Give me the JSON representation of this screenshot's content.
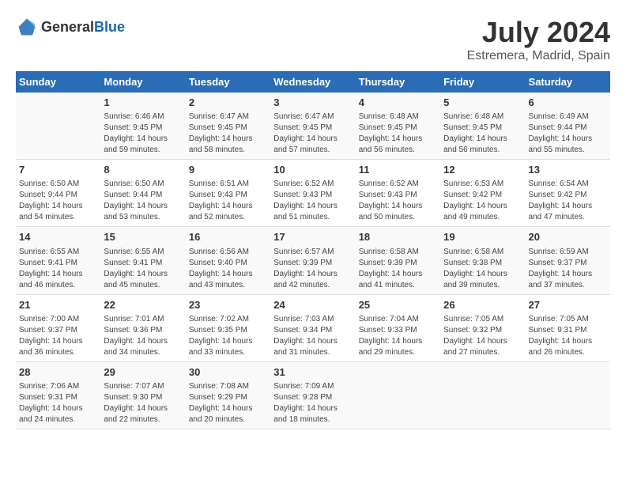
{
  "header": {
    "logo_general": "General",
    "logo_blue": "Blue",
    "title": "July 2024",
    "subtitle": "Estremera, Madrid, Spain"
  },
  "columns": [
    "Sunday",
    "Monday",
    "Tuesday",
    "Wednesday",
    "Thursday",
    "Friday",
    "Saturday"
  ],
  "weeks": [
    [
      {
        "day": "",
        "sunrise": "",
        "sunset": "",
        "daylight": ""
      },
      {
        "day": "1",
        "sunrise": "Sunrise: 6:46 AM",
        "sunset": "Sunset: 9:45 PM",
        "daylight": "Daylight: 14 hours and 59 minutes."
      },
      {
        "day": "2",
        "sunrise": "Sunrise: 6:47 AM",
        "sunset": "Sunset: 9:45 PM",
        "daylight": "Daylight: 14 hours and 58 minutes."
      },
      {
        "day": "3",
        "sunrise": "Sunrise: 6:47 AM",
        "sunset": "Sunset: 9:45 PM",
        "daylight": "Daylight: 14 hours and 57 minutes."
      },
      {
        "day": "4",
        "sunrise": "Sunrise: 6:48 AM",
        "sunset": "Sunset: 9:45 PM",
        "daylight": "Daylight: 14 hours and 56 minutes."
      },
      {
        "day": "5",
        "sunrise": "Sunrise: 6:48 AM",
        "sunset": "Sunset: 9:45 PM",
        "daylight": "Daylight: 14 hours and 56 minutes."
      },
      {
        "day": "6",
        "sunrise": "Sunrise: 6:49 AM",
        "sunset": "Sunset: 9:44 PM",
        "daylight": "Daylight: 14 hours and 55 minutes."
      }
    ],
    [
      {
        "day": "7",
        "sunrise": "Sunrise: 6:50 AM",
        "sunset": "Sunset: 9:44 PM",
        "daylight": "Daylight: 14 hours and 54 minutes."
      },
      {
        "day": "8",
        "sunrise": "Sunrise: 6:50 AM",
        "sunset": "Sunset: 9:44 PM",
        "daylight": "Daylight: 14 hours and 53 minutes."
      },
      {
        "day": "9",
        "sunrise": "Sunrise: 6:51 AM",
        "sunset": "Sunset: 9:43 PM",
        "daylight": "Daylight: 14 hours and 52 minutes."
      },
      {
        "day": "10",
        "sunrise": "Sunrise: 6:52 AM",
        "sunset": "Sunset: 9:43 PM",
        "daylight": "Daylight: 14 hours and 51 minutes."
      },
      {
        "day": "11",
        "sunrise": "Sunrise: 6:52 AM",
        "sunset": "Sunset: 9:43 PM",
        "daylight": "Daylight: 14 hours and 50 minutes."
      },
      {
        "day": "12",
        "sunrise": "Sunrise: 6:53 AM",
        "sunset": "Sunset: 9:42 PM",
        "daylight": "Daylight: 14 hours and 49 minutes."
      },
      {
        "day": "13",
        "sunrise": "Sunrise: 6:54 AM",
        "sunset": "Sunset: 9:42 PM",
        "daylight": "Daylight: 14 hours and 47 minutes."
      }
    ],
    [
      {
        "day": "14",
        "sunrise": "Sunrise: 6:55 AM",
        "sunset": "Sunset: 9:41 PM",
        "daylight": "Daylight: 14 hours and 46 minutes."
      },
      {
        "day": "15",
        "sunrise": "Sunrise: 6:55 AM",
        "sunset": "Sunset: 9:41 PM",
        "daylight": "Daylight: 14 hours and 45 minutes."
      },
      {
        "day": "16",
        "sunrise": "Sunrise: 6:56 AM",
        "sunset": "Sunset: 9:40 PM",
        "daylight": "Daylight: 14 hours and 43 minutes."
      },
      {
        "day": "17",
        "sunrise": "Sunrise: 6:57 AM",
        "sunset": "Sunset: 9:39 PM",
        "daylight": "Daylight: 14 hours and 42 minutes."
      },
      {
        "day": "18",
        "sunrise": "Sunrise: 6:58 AM",
        "sunset": "Sunset: 9:39 PM",
        "daylight": "Daylight: 14 hours and 41 minutes."
      },
      {
        "day": "19",
        "sunrise": "Sunrise: 6:58 AM",
        "sunset": "Sunset: 9:38 PM",
        "daylight": "Daylight: 14 hours and 39 minutes."
      },
      {
        "day": "20",
        "sunrise": "Sunrise: 6:59 AM",
        "sunset": "Sunset: 9:37 PM",
        "daylight": "Daylight: 14 hours and 37 minutes."
      }
    ],
    [
      {
        "day": "21",
        "sunrise": "Sunrise: 7:00 AM",
        "sunset": "Sunset: 9:37 PM",
        "daylight": "Daylight: 14 hours and 36 minutes."
      },
      {
        "day": "22",
        "sunrise": "Sunrise: 7:01 AM",
        "sunset": "Sunset: 9:36 PM",
        "daylight": "Daylight: 14 hours and 34 minutes."
      },
      {
        "day": "23",
        "sunrise": "Sunrise: 7:02 AM",
        "sunset": "Sunset: 9:35 PM",
        "daylight": "Daylight: 14 hours and 33 minutes."
      },
      {
        "day": "24",
        "sunrise": "Sunrise: 7:03 AM",
        "sunset": "Sunset: 9:34 PM",
        "daylight": "Daylight: 14 hours and 31 minutes."
      },
      {
        "day": "25",
        "sunrise": "Sunrise: 7:04 AM",
        "sunset": "Sunset: 9:33 PM",
        "daylight": "Daylight: 14 hours and 29 minutes."
      },
      {
        "day": "26",
        "sunrise": "Sunrise: 7:05 AM",
        "sunset": "Sunset: 9:32 PM",
        "daylight": "Daylight: 14 hours and 27 minutes."
      },
      {
        "day": "27",
        "sunrise": "Sunrise: 7:05 AM",
        "sunset": "Sunset: 9:31 PM",
        "daylight": "Daylight: 14 hours and 26 minutes."
      }
    ],
    [
      {
        "day": "28",
        "sunrise": "Sunrise: 7:06 AM",
        "sunset": "Sunset: 9:31 PM",
        "daylight": "Daylight: 14 hours and 24 minutes."
      },
      {
        "day": "29",
        "sunrise": "Sunrise: 7:07 AM",
        "sunset": "Sunset: 9:30 PM",
        "daylight": "Daylight: 14 hours and 22 minutes."
      },
      {
        "day": "30",
        "sunrise": "Sunrise: 7:08 AM",
        "sunset": "Sunset: 9:29 PM",
        "daylight": "Daylight: 14 hours and 20 minutes."
      },
      {
        "day": "31",
        "sunrise": "Sunrise: 7:09 AM",
        "sunset": "Sunset: 9:28 PM",
        "daylight": "Daylight: 14 hours and 18 minutes."
      },
      {
        "day": "",
        "sunrise": "",
        "sunset": "",
        "daylight": ""
      },
      {
        "day": "",
        "sunrise": "",
        "sunset": "",
        "daylight": ""
      },
      {
        "day": "",
        "sunrise": "",
        "sunset": "",
        "daylight": ""
      }
    ]
  ]
}
